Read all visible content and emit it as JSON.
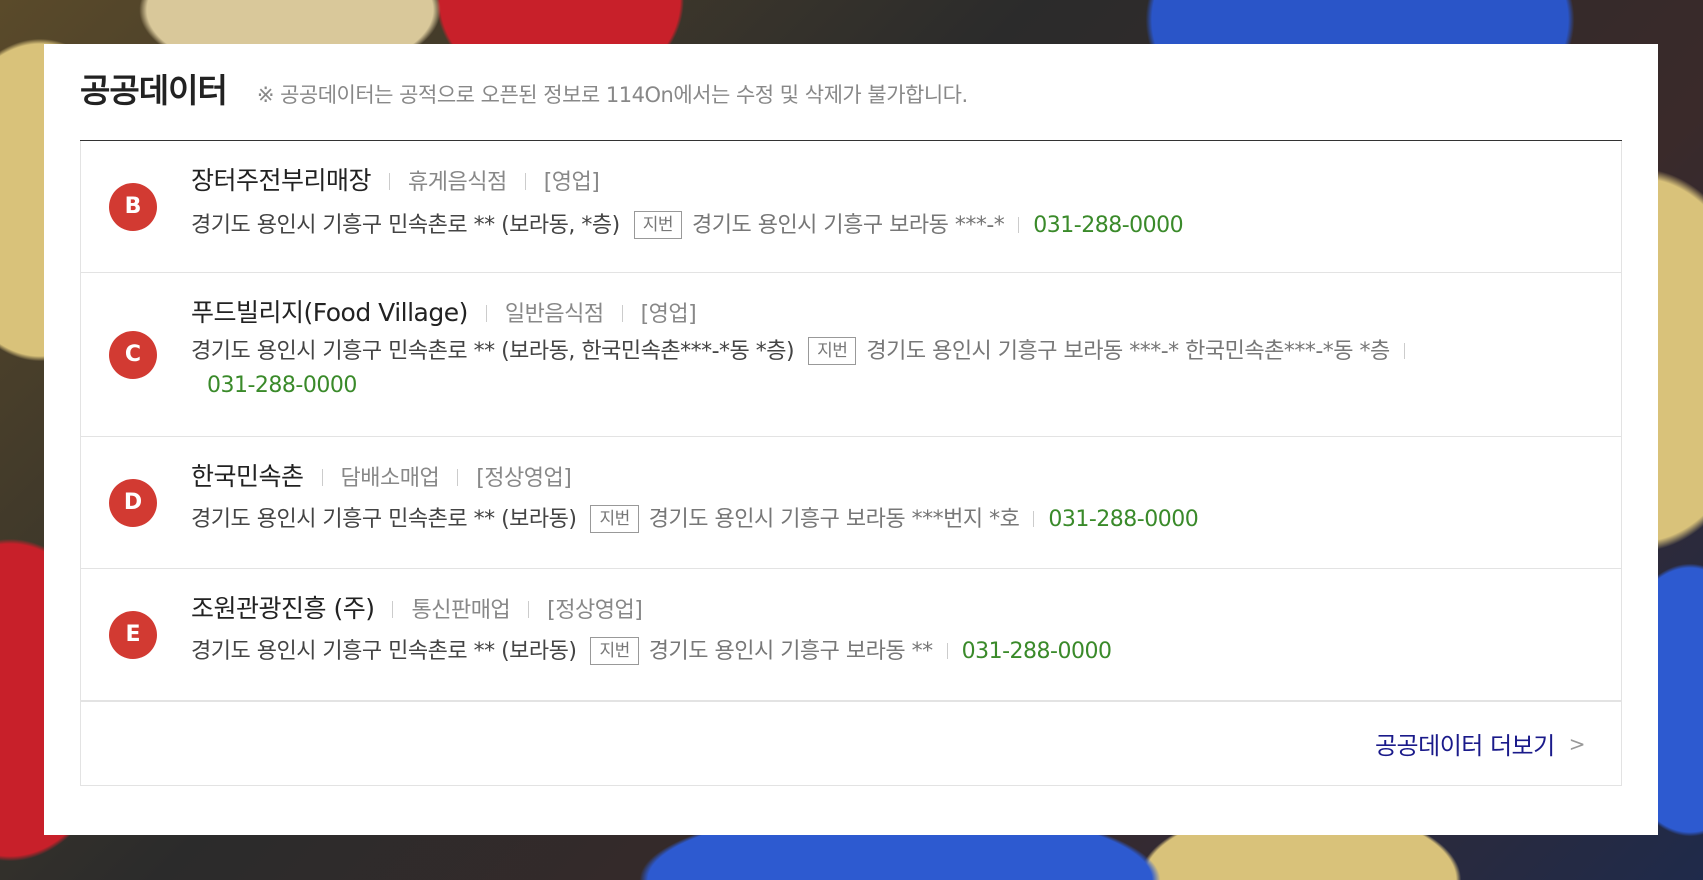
{
  "header": {
    "title": "공공데이터",
    "notice": "※ 공공데이터는 공적으로 오픈된 정보로 114On에서는 수정 및 삭제가 불가합니다."
  },
  "items": [
    {
      "marker": "B",
      "name": "장터주전부리매장",
      "category": "휴게음식점",
      "status": "[영업]",
      "road_address": "경기도 용인시 기흥구 민속촌로 ** (보라동, *층)",
      "jibun_label": "지번",
      "jibun_address": "경기도 용인시 기흥구 보라동 ***-*",
      "phone": "031-288-0000"
    },
    {
      "marker": "C",
      "name": "푸드빌리지(Food Village)",
      "category": "일반음식점",
      "status": "[영업]",
      "road_address": "경기도 용인시 기흥구 민속촌로 ** (보라동, 한국민속촌***-*동 *층)",
      "jibun_label": "지번",
      "jibun_address": "경기도 용인시 기흥구 보라동 ***-* 한국민속촌***-*동 *층",
      "phone": "031-288-0000"
    },
    {
      "marker": "D",
      "name": "한국민속촌",
      "category": "담배소매업",
      "status": "[정상영업]",
      "road_address": "경기도 용인시 기흥구 민속촌로 ** (보라동)",
      "jibun_label": "지번",
      "jibun_address": "경기도 용인시 기흥구 보라동 ***번지 *호",
      "phone": "031-288-0000"
    },
    {
      "marker": "E",
      "name": "조원관광진흥 (주)",
      "category": "통신판매업",
      "status": "[정상영업]",
      "road_address": "경기도 용인시 기흥구 민속촌로 ** (보라동)",
      "jibun_label": "지번",
      "jibun_address": "경기도 용인시 기흥구 보라동 **",
      "phone": "031-288-0000"
    }
  ],
  "more_link": {
    "label": "공공데이터 더보기",
    "icon": "chevron-right-icon"
  },
  "colors": {
    "marker": "#d23a32",
    "phone": "#3a8a2a",
    "link": "#1a1a8a"
  }
}
